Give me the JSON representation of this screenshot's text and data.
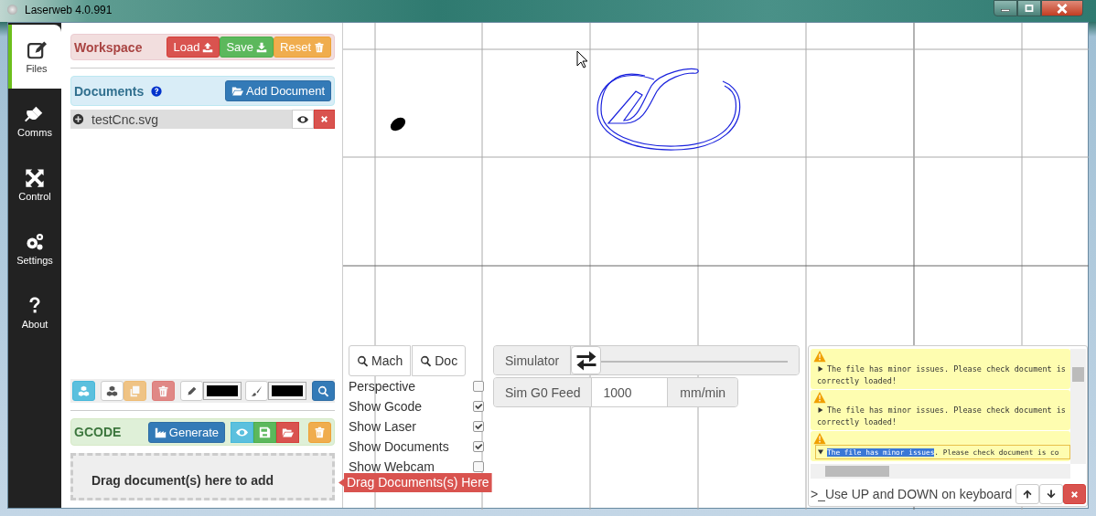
{
  "window": {
    "title": "Laserweb 4.0.991"
  },
  "sidebar": {
    "items": [
      {
        "label": "Files",
        "selected": true
      },
      {
        "label": "Comms",
        "selected": false
      },
      {
        "label": "Control",
        "selected": false
      },
      {
        "label": "Settings",
        "selected": false
      },
      {
        "label": "About",
        "selected": false
      }
    ]
  },
  "workspace": {
    "title": "Workspace",
    "buttons": [
      "Load",
      "Save",
      "Reset"
    ]
  },
  "documents": {
    "title": "Documents",
    "add_button": "Add Document",
    "files": [
      {
        "name": "testCnc.svg"
      }
    ]
  },
  "toolbar": {
    "items": [
      {
        "kind": "button",
        "disabled": false
      },
      {
        "kind": "button",
        "disabled": false
      },
      {
        "kind": "button",
        "disabled": true
      },
      {
        "kind": "button",
        "disabled": true
      },
      {
        "kind": "button",
        "disabled": false
      },
      {
        "kind": "swatch",
        "color": "#000000"
      },
      {
        "kind": "button",
        "disabled": false
      },
      {
        "kind": "swatch",
        "color": "#000000"
      },
      {
        "kind": "button",
        "disabled": false
      }
    ]
  },
  "gcode": {
    "title": "GCODE",
    "generate": "Generate",
    "drop_hint": "Drag document(s) here to add"
  },
  "drop_tooltip": "Drag Documents(s) Here",
  "view": {
    "buttons": [
      "Mach",
      "Doc"
    ],
    "options": [
      {
        "label": "Perspective",
        "checked": false
      },
      {
        "label": "Show Gcode",
        "checked": true
      },
      {
        "label": "Show Laser",
        "checked": true
      },
      {
        "label": "Show Documents",
        "checked": true
      },
      {
        "label": "Show Webcam",
        "checked": false
      }
    ]
  },
  "simulator": {
    "label": "Simulator",
    "level": 0
  },
  "feed": {
    "label": "Sim G0 Feed",
    "value": "1000",
    "unit": "mm/min"
  },
  "console": {
    "messages": [
      {
        "text": "The file has minor issues. Please check document is correctly loaded!",
        "expanded": false
      },
      {
        "text": "The file has minor issues. Please check document is correctly loaded!",
        "expanded": false
      },
      {
        "highlight": "The file has minor issues",
        "text": ". Please check document is co",
        "expanded": true
      }
    ],
    "prompt": ">_",
    "placeholder": "Use UP and DOWN on keyboard"
  }
}
